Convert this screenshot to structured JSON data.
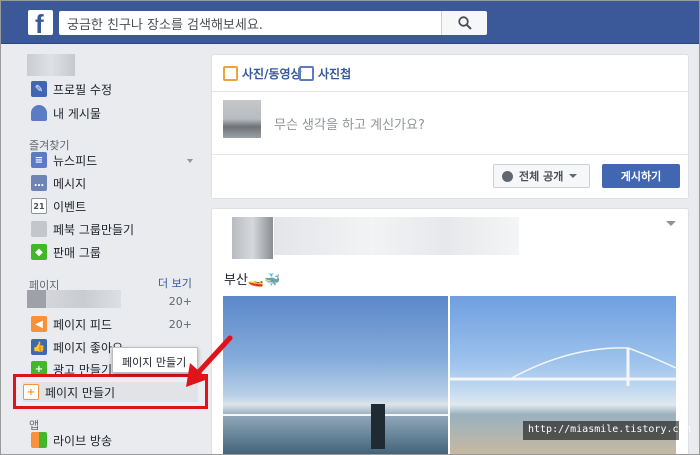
{
  "search": {
    "placeholder": "궁금한 친구나 장소를 검색해보세요."
  },
  "brand": {
    "logo_letter": "f",
    "color": "#3b5998"
  },
  "sidebar": {
    "profile_links": [
      {
        "label": "프로필 수정",
        "icon": "pencil-icon"
      },
      {
        "label": "내 게시물",
        "icon": "person-icon"
      }
    ],
    "favorites_heading": "즐겨찾기",
    "favorites": [
      {
        "label": "뉴스피드",
        "icon": "newsfeed-icon"
      },
      {
        "label": "메시지",
        "icon": "messages-icon"
      },
      {
        "label": "이벤트",
        "icon": "calendar-icon",
        "icon_text": "21"
      },
      {
        "label": "페북 그룹만들기",
        "icon": "group-icon"
      },
      {
        "label": "판매 그룹",
        "icon": "tag-icon"
      }
    ],
    "pages_heading": "페이지",
    "pages_more": "더 보기",
    "pages": [
      {
        "label": "",
        "count": "20+"
      },
      {
        "label": "페이지 피드",
        "count": "20+",
        "icon": "megaphone-icon"
      },
      {
        "label": "페이지 좋아요",
        "icon": "thumbs-up-icon"
      },
      {
        "label": "광고 만들기",
        "icon": "ads-icon"
      },
      {
        "label": "페이지 만들기",
        "icon": "create-page-icon"
      }
    ],
    "apps_heading": "앱",
    "apps": [
      {
        "label": "라이브 방송",
        "icon": "live-icon"
      }
    ],
    "tooltip": "페이지 만들기"
  },
  "composer": {
    "tab_photo": "사진/동영상",
    "tab_album": "사진첩",
    "placeholder": "무슨 생각을 하고 계신가요?",
    "audience": "전체 공개",
    "post_button": "게시하기"
  },
  "post": {
    "text": "부산🚤🐳"
  },
  "watermark": "http://miasmile.tistory.com",
  "colors": {
    "highlight": "#e0131a",
    "primary_button": "#4267b2",
    "link": "#365899"
  }
}
